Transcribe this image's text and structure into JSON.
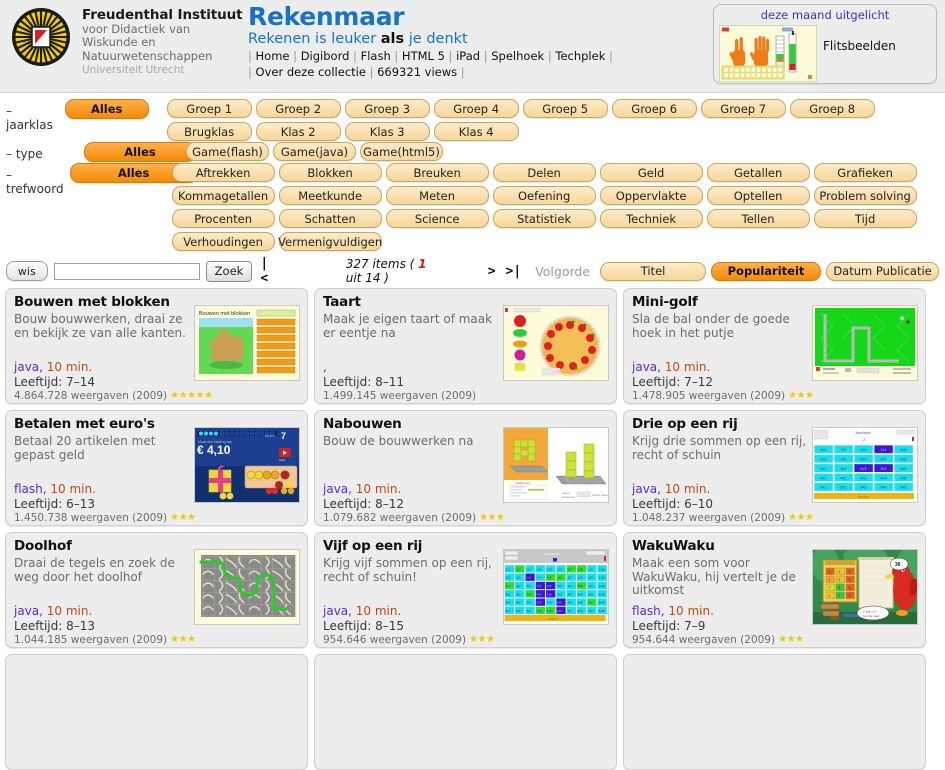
{
  "header": {
    "institute_title": "Freudenthal Instituut",
    "institute_line1": "voor Didactiek van",
    "institute_line2": "Wiskunde en",
    "institute_line3": "Natuurwetenschappen",
    "institute_line4": "Universiteit Utrecht",
    "brand_title": "Rekenmaar",
    "slogan_part1": "Rekenen is leuker ",
    "slogan_als": "als",
    "slogan_part2": " je denkt",
    "nav_items": [
      "Home",
      "Digibord",
      "Flash",
      "HTML 5",
      "iPad",
      "Spelhoek",
      "Techplek"
    ],
    "subnav_collection": "Over deze collectie",
    "subnav_views": "669321 views",
    "promo_title": "deze maand uitgelicht",
    "promo_label": "Flitsbeelden",
    "accent_blue": "#1a72c4",
    "accent_purple": "#3b34c8"
  },
  "filters": {
    "rows": [
      {
        "label": "– jaarklas",
        "all_label": "Alles",
        "all_selected": true,
        "items": [
          "Groep 1",
          "Groep 2",
          "Groep 3",
          "Groep 4",
          "Groep 5",
          "Groep 6",
          "Groep 7",
          "Groep 8",
          "Brugklas",
          "Klas 2",
          "Klas 3",
          "Klas 4"
        ]
      },
      {
        "label": "– type",
        "all_label": "Alles",
        "all_selected": true,
        "items": [
          "Game(flash)",
          "Game(java)",
          "Game(html5)"
        ]
      },
      {
        "label": "– trefwoord",
        "all_label": "Alles",
        "all_selected": true,
        "items": [
          "Aftrekken",
          "Blokken",
          "Breuken",
          "Delen",
          "Geld",
          "Getallen",
          "Grafieken",
          "Kommagetallen",
          "Meetkunde",
          "Meten",
          "Oefening",
          "Oppervlakte",
          "Optellen",
          "Problem solving",
          "Procenten",
          "Schatten",
          "Science",
          "Statistiek",
          "Techniek",
          "Tellen",
          "Tijd",
          "Verhoudingen",
          "Vermenigvuldigen"
        ]
      }
    ],
    "selected_color": "#f58a06"
  },
  "toolbar": {
    "clear_label": "wis",
    "search_value": "",
    "search_placeholder": "",
    "search_button_label": "Zoek",
    "first_page_label": "|<",
    "next_page_label": ">",
    "last_page_label": ">|",
    "items_prefix": "327 items ( ",
    "current_page": "1",
    "items_suffix": " uit 14 )",
    "order_label": "Volgorde",
    "order_options": [
      {
        "label": "Titel",
        "selected": false
      },
      {
        "label": "Populariteit",
        "selected": true
      },
      {
        "label": "Datum Publicatie",
        "selected": false
      }
    ]
  },
  "cards": [
    {
      "title": "Bouwen met blokken",
      "description": "Bouw bouwwerken, draai ze en bekijk ze van alle kanten.",
      "type": "java",
      "duration": "10 min.",
      "age_label": "Leeftijd: 7–14",
      "views": "4.864.728 weergaven (2009)",
      "stars": 5,
      "thumb": "bouwen"
    },
    {
      "title": "Taart",
      "description": "Maak je eigen taart of maak er eentje na",
      "type": ",",
      "duration": "",
      "age_label": "Leeftijd: 8–11",
      "views": "1.499.145 weergaven (2009)",
      "stars": 0,
      "thumb": "taart"
    },
    {
      "title": "Mini-golf",
      "description": "Sla de bal onder de goede hoek in het putje",
      "type": "java",
      "duration": "10 min.",
      "age_label": "Leeftijd: 7–12",
      "views": "1.478.905 weergaven (2009)",
      "stars": 3,
      "thumb": "minigolf"
    },
    {
      "title": "Betalen met euro's",
      "description": "Betaal 20 artikelen met gepast geld",
      "type": "flash",
      "duration": "10 min.",
      "age_label": "Leeftijd: 6–13",
      "views": "1.450.738 weergaven (2009)",
      "stars": 3,
      "thumb": "euro"
    },
    {
      "title": "Nabouwen",
      "description": "Bouw de bouwwerken na",
      "type": "java",
      "duration": "10 min.",
      "age_label": "Leeftijd: 8–12",
      "views": "1.079.682 weergaven (2009)",
      "stars": 3,
      "thumb": "nabouwen"
    },
    {
      "title": "Drie op een rij",
      "description": "Krijg drie sommen op een rij, recht of schuin",
      "type": "java",
      "duration": "10 min.",
      "age_label": "Leeftijd: 6–10",
      "views": "1.048.237 weergaven (2009)",
      "stars": 3,
      "thumb": "drieoprij"
    },
    {
      "title": "Doolhof",
      "description": "Draai de tegels en zoek de weg door het doolhof",
      "type": "java",
      "duration": "10 min.",
      "age_label": "Leeftijd: 8–13",
      "views": "1.044.185 weergaven (2009)",
      "stars": 3,
      "thumb": "doolhof"
    },
    {
      "title": "Vijf op een rij",
      "description": "Krijg vijf sommen op een rij, recht of schuin!",
      "type": "java",
      "duration": "10 min.",
      "age_label": "Leeftijd: 8–15",
      "views": "954.646 weergaven (2009)",
      "stars": 3,
      "thumb": "vijfoprij"
    },
    {
      "title": "WakuWaku",
      "description": "Maak een som voor WakuWaku, hij vertelt je de uitkomst",
      "type": "flash",
      "duration": "10 min.",
      "age_label": "Leeftijd: 7–9",
      "views": "954.644 weergaven (2009)",
      "stars": 3,
      "thumb": "wakuwaku"
    }
  ]
}
